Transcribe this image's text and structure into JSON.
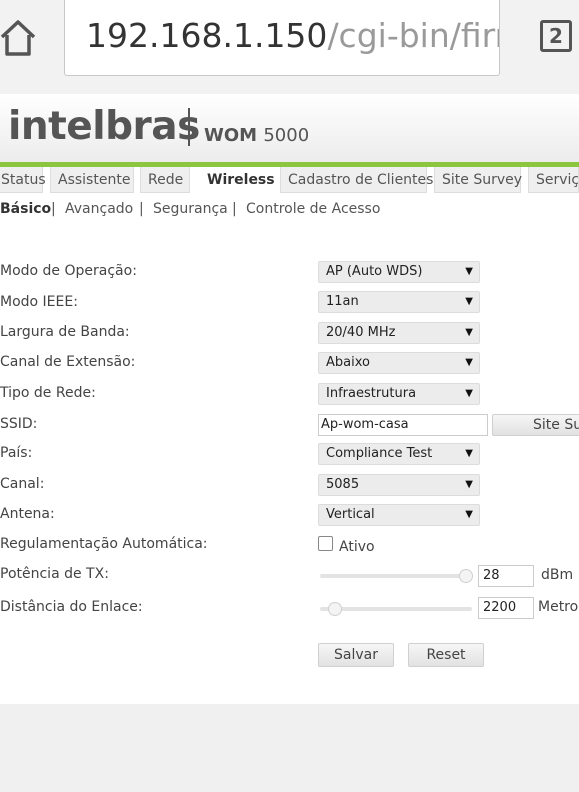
{
  "browser": {
    "url_host": "192.168.1.150",
    "url_path": "/cgi-bin/firm",
    "tab_count": "2",
    "icons": {
      "home": "home-icon"
    }
  },
  "header": {
    "logo": "intelbras",
    "product_prefix": "WOM",
    "product_model": "5000",
    "accent_color": "#8cc63e"
  },
  "tabs": [
    {
      "label": "Status"
    },
    {
      "label": "Assistente"
    },
    {
      "label": "Rede"
    },
    {
      "label": "Wireless",
      "active": true
    },
    {
      "label": "Cadastro de Clientes"
    },
    {
      "label": "Site Survey"
    },
    {
      "label": "Serviços"
    }
  ],
  "subnav": [
    {
      "label": "Básico",
      "active": true
    },
    {
      "label": "Avançado"
    },
    {
      "label": "Segurança"
    },
    {
      "label": "Controle de Acesso"
    }
  ],
  "subnav_separator": "|",
  "form": {
    "modo_operacao": {
      "label": "Modo de Operação:",
      "value": "AP (Auto WDS)"
    },
    "modo_ieee": {
      "label": "Modo IEEE:",
      "value": "11an"
    },
    "largura_banda": {
      "label": "Largura de Banda:",
      "value": "20/40 MHz"
    },
    "canal_extensao": {
      "label": "Canal de Extensão:",
      "value": "Abaixo"
    },
    "tipo_rede": {
      "label": "Tipo de Rede:",
      "value": "Infraestrutura"
    },
    "ssid": {
      "label": "SSID:",
      "value": "Ap-wom-casa",
      "button": "Site Survey"
    },
    "pais": {
      "label": "País:",
      "value": "Compliance Test"
    },
    "canal": {
      "label": "Canal:",
      "value": "5085"
    },
    "antena": {
      "label": "Antena:",
      "value": "Vertical"
    },
    "regulamentacao": {
      "label": "Regulamentação Automática:",
      "checkbox_label": "Ativo",
      "checked": false
    },
    "potencia_tx": {
      "label": "Potência de TX:",
      "value": "28",
      "unit": "dBm",
      "slider_fraction": 0.97
    },
    "distancia": {
      "label": "Distância do Enlace:",
      "value": "2200",
      "unit": "Metros",
      "slider_fraction": 0.1
    }
  },
  "buttons": {
    "save": "Salvar",
    "reset": "Reset"
  },
  "dropdown_arrow": "▼"
}
